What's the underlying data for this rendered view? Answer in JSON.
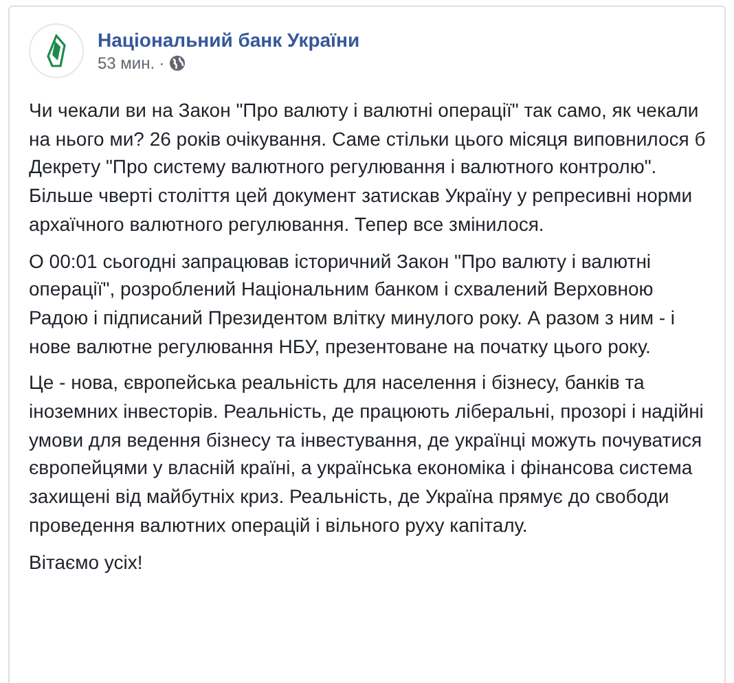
{
  "post": {
    "author": "Національний банк України",
    "time": "53 мин.",
    "separator": "·",
    "paragraphs": [
      "Чи чекали ви на Закон \"Про валюту і валютні операції\" так само, як чекали на нього ми? 26 років очікування. Саме стільки цього місяця виповнилося б Декрету \"Про систему валютного регулювання і валютного контролю\". Більше чверті століття цей документ затискав Україну у репресивні норми архаїчного валютного регулювання. Тепер все змінилося.",
      "О 00:01 сьогодні запрацював історичний Закон \"Про валюту і валютні операції\", розроблений Національним банком і схвалений Верховною Радою і підписаний Президентом влітку минулого року. А разом з ним - і нове валютне регулювання НБУ, презентоване на початку цього року.",
      "Це - нова, європейська реальність для населення і бізнесу, банків та іноземних інвесторів. Реальність, де працюють ліберальні, прозорі і надійні умови для ведення бізнесу та інвестування, де українці можуть почуватися європейцями у власній країні, а українська економіка і фінансова система захищені від майбутніх криз. Реальність, де Україна прямує до свободи проведення валютних операцій і вільного руху капіталу.",
      "Вітаємо усіх!"
    ]
  }
}
